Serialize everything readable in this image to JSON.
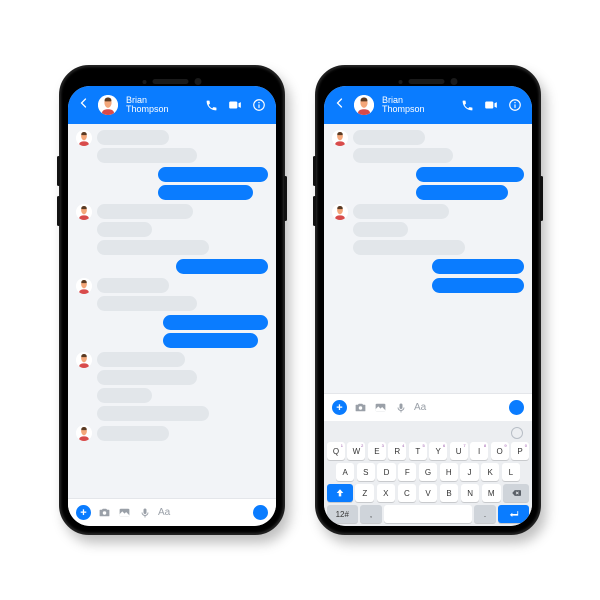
{
  "colors": {
    "primary": "#0a7cff",
    "bubble_in": "#e2e6ea",
    "bg": "#f2f4f7"
  },
  "contact": {
    "name_line1": "Brian",
    "name_line2": "Thompson"
  },
  "composer": {
    "placeholder": "Aa"
  },
  "phone1": {
    "chat": [
      {
        "side": "in",
        "avatar": true,
        "widths": [
          72,
          100
        ]
      },
      {
        "side": "out",
        "avatar": false,
        "widths": [
          110,
          95
        ]
      },
      {
        "side": "in",
        "avatar": true,
        "widths": [
          96,
          55,
          112
        ]
      },
      {
        "side": "out",
        "avatar": false,
        "widths": [
          92
        ]
      },
      {
        "side": "in",
        "avatar": true,
        "widths": [
          72,
          100
        ]
      },
      {
        "side": "out",
        "avatar": false,
        "widths": [
          105,
          95
        ]
      },
      {
        "side": "in",
        "avatar": true,
        "widths": [
          88,
          100,
          55,
          112
        ]
      },
      {
        "side": "in",
        "avatar": true,
        "widths": [
          72
        ]
      }
    ]
  },
  "phone2": {
    "chat": [
      {
        "side": "in",
        "avatar": true,
        "widths": [
          72,
          100
        ]
      },
      {
        "side": "out",
        "avatar": false,
        "widths": [
          108,
          92
        ]
      },
      {
        "side": "in",
        "avatar": true,
        "widths": [
          96,
          55,
          112
        ]
      },
      {
        "side": "out",
        "avatar": false,
        "widths": [
          92
        ]
      },
      {
        "side": "out",
        "avatar": false,
        "widths": [
          92
        ]
      }
    ]
  },
  "keyboard": {
    "row1": [
      {
        "k": "Q",
        "s": "1"
      },
      {
        "k": "W",
        "s": "2"
      },
      {
        "k": "E",
        "s": "3"
      },
      {
        "k": "R",
        "s": "4"
      },
      {
        "k": "T",
        "s": "5"
      },
      {
        "k": "Y",
        "s": "6"
      },
      {
        "k": "U",
        "s": "7"
      },
      {
        "k": "I",
        "s": "8"
      },
      {
        "k": "O",
        "s": "9"
      },
      {
        "k": "P",
        "s": "0"
      }
    ],
    "row2": [
      {
        "k": "A",
        "s": ""
      },
      {
        "k": "S",
        "s": ""
      },
      {
        "k": "D",
        "s": ""
      },
      {
        "k": "F",
        "s": ""
      },
      {
        "k": "G",
        "s": ""
      },
      {
        "k": "H",
        "s": ""
      },
      {
        "k": "J",
        "s": ""
      },
      {
        "k": "K",
        "s": ""
      },
      {
        "k": "L",
        "s": ""
      }
    ],
    "row3": [
      {
        "k": "Z"
      },
      {
        "k": "X"
      },
      {
        "k": "C"
      },
      {
        "k": "V"
      },
      {
        "k": "B"
      },
      {
        "k": "N"
      },
      {
        "k": "M"
      }
    ],
    "sym_key": "12#",
    "comma": ",",
    "space": "",
    "period": "."
  }
}
